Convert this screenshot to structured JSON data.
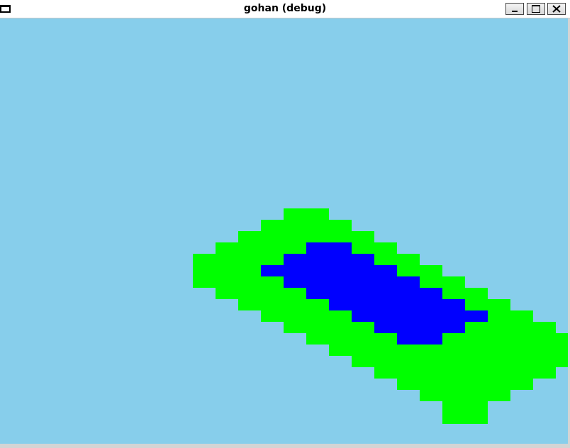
{
  "window": {
    "title": "gohan (debug)",
    "buttons": {
      "minimize_icon": "minimize-icon",
      "maximize_icon": "maximize-icon",
      "close_icon": "close-icon"
    }
  },
  "scene": {
    "background_color": "#87ceeb",
    "fill_colors": {
      "outer": "#00ff00",
      "inner": "#0000ff"
    },
    "description_icon": "voxel-blob"
  }
}
